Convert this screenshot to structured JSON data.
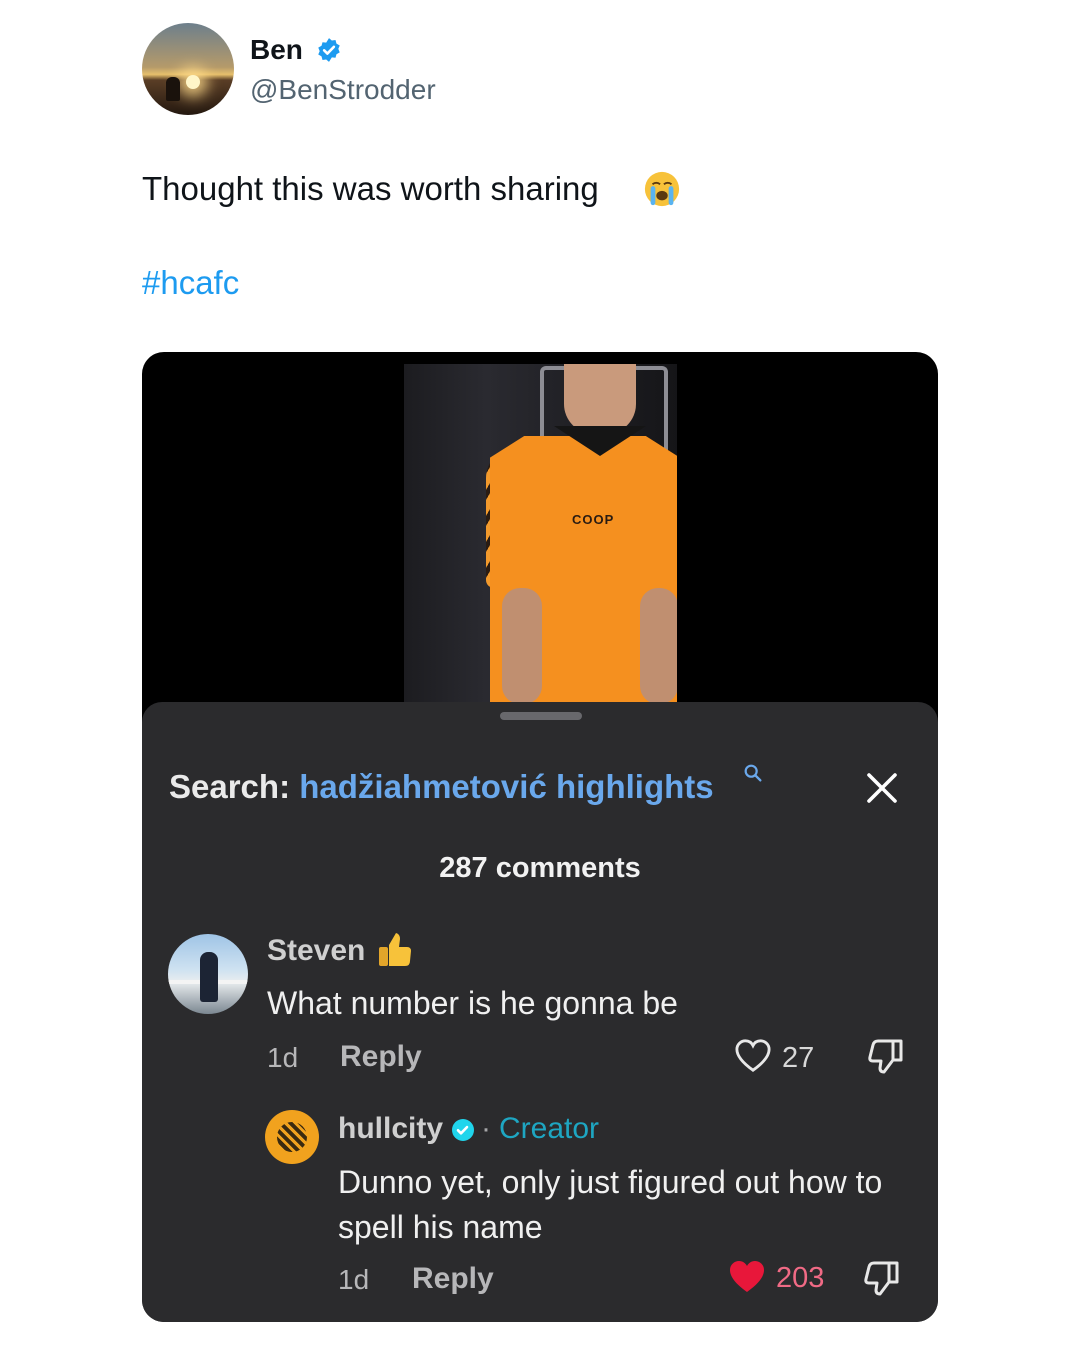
{
  "tweet": {
    "author_name": "Ben",
    "author_handle": "@BenStrodder",
    "text": "Thought this was worth sharing",
    "hashtag": "#hcafc"
  },
  "video": {
    "sponsor_text": "COOP"
  },
  "comments_sheet": {
    "search_label": "Search:",
    "search_query": "hadžiahmetović highlights",
    "comment_count": "287 comments",
    "comments": [
      {
        "username": "Steven",
        "text": "What number is he gonna be",
        "time": "1d",
        "reply_label": "Reply",
        "likes": "27",
        "liked": false
      },
      {
        "username": "hullcity",
        "badge": "Creator",
        "separator": "·",
        "text": "Dunno yet, only just figured out how to spell his name",
        "time": "1d",
        "reply_label": "Reply",
        "likes": "203",
        "liked": true
      }
    ]
  },
  "colors": {
    "link_blue": "#1d9bf0",
    "sheet_bg": "#2b2b2d",
    "creator_teal": "#1ea6c2",
    "like_red": "#e8173a"
  }
}
